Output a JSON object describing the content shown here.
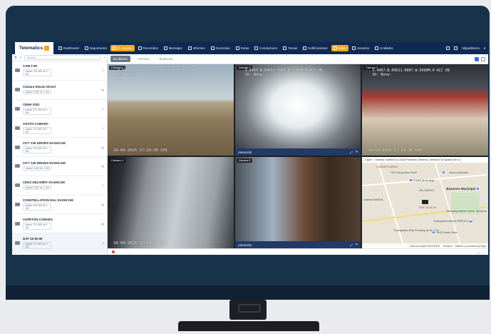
{
  "nav": {
    "logo": "Telematics",
    "items": [
      {
        "label": "Dashboard",
        "active": false
      },
      {
        "label": "Seguimiento",
        "active": false
      },
      {
        "label": "E. Asocies",
        "active": true
      },
      {
        "label": "Recorridos",
        "active": false
      },
      {
        "label": "Mensajes",
        "active": false
      },
      {
        "label": "Informes",
        "active": false
      },
      {
        "label": "Geozonas",
        "active": false
      },
      {
        "label": "Rutas",
        "active": false
      },
      {
        "label": "Conductores",
        "active": false
      },
      {
        "label": "Tareas",
        "active": false
      },
      {
        "label": "Notificaciones",
        "active": false
      },
      {
        "label": "Video",
        "active": true
      },
      {
        "label": "Usuarios",
        "active": false
      },
      {
        "label": "Unidades",
        "active": false
      }
    ],
    "user": "MiguelBarca"
  },
  "sidebar": {
    "search_placeholder": "Buscar",
    "units": [
      {
        "name": "CAM T-90",
        "status": "Usado 230 MB de 1 GB",
        "count": "1"
      },
      {
        "name": "Cámara Nissan Diesel",
        "status": "Usado 0 MB de 1 GB",
        "count": "2g"
      },
      {
        "name": "CEMX 0201",
        "status": "Usado 227 MB de 1 GB",
        "count": "1"
      },
      {
        "name": "CHATO CAMARA",
        "status": "Usado 722 MB de 1 GB",
        "count": "1"
      },
      {
        "name": "CITY 130 DRIVES DASHCAM",
        "status": "Usado 722 MB de 1 GB",
        "count": "2g"
      },
      {
        "name": "CITY 130 DRIVES DASHCAM",
        "status": "Usado 0 MB de 1 GB",
        "count": "2g"
      },
      {
        "name": "CMX2 DELIVERY DASHCAM",
        "status": "Usado 0 MB de 1 GB",
        "count": "1"
      },
      {
        "name": "CONSTELLATION DAL DASHCAM",
        "status": "Usado 260 MB de 1 GB",
        "count": "2g"
      },
      {
        "name": "CUPETON CAMARA",
        "status": "Usado 722 MB de 1 GB",
        "count": "2g"
      },
      {
        "name": "DAF 15-IN-06",
        "status": "Usado 171 MB de 1 GB",
        "count": "1"
      }
    ]
  },
  "toolbar": {
    "tabs": [
      "En directo",
      "Archivos",
      "Evolución"
    ]
  },
  "cameras": [
    {
      "label": "Cámara 1",
      "osd1": "3.4907.N.09611.0087.W.0000M.H ACC ON",
      "osd2": "ID: None:",
      "timestamp": "19-09-2025 17:29:36  CH1"
    },
    {
      "label": "Cámara 2",
      "osd1": "3.4907.N.09611.0087.W.0000M.H ACC ON",
      "osd2": "ID: None:",
      "alert": "¡Atención!"
    },
    {
      "label": "Cámara 3",
      "osd1": "3.4907.N.09611.0087.W.0000M.H ACC ON",
      "osd2": "ID: None:",
      "timestamp": "19-09-2025 17:29:36  CH3"
    },
    {
      "label": "Cámara 4",
      "timestamp": "19-09-2025 17:29:36  CH4"
    },
    {
      "label": "Cámara 5",
      "alert": "¡Atención!"
    }
  ],
  "map": {
    "header": "2 dpch · Corredor Auxiliar A La Zona Portuaria, Veracruz, Veracruz De Ignacio De La",
    "labels": [
      "LEMARTICARGO",
      "HH Transportes Farro",
      "Nuevo Alvarado",
      "El sotol de la vieja",
      "Rio CARGO",
      "Basurero Municipal",
      "puertos MAEDA",
      "DAF 15-IN-06",
      "Descomposición Crane, Veracruz",
      "Transportes Alteon PERLA CAUJ",
      "Transportes Eltra Trucking de Alt. S.A",
      "GKE Puerto Seco"
    ],
    "footer_items": [
      "Datos del mapa ©2025 INEGI",
      "Términos",
      "Notificar un problema de Maps"
    ]
  }
}
